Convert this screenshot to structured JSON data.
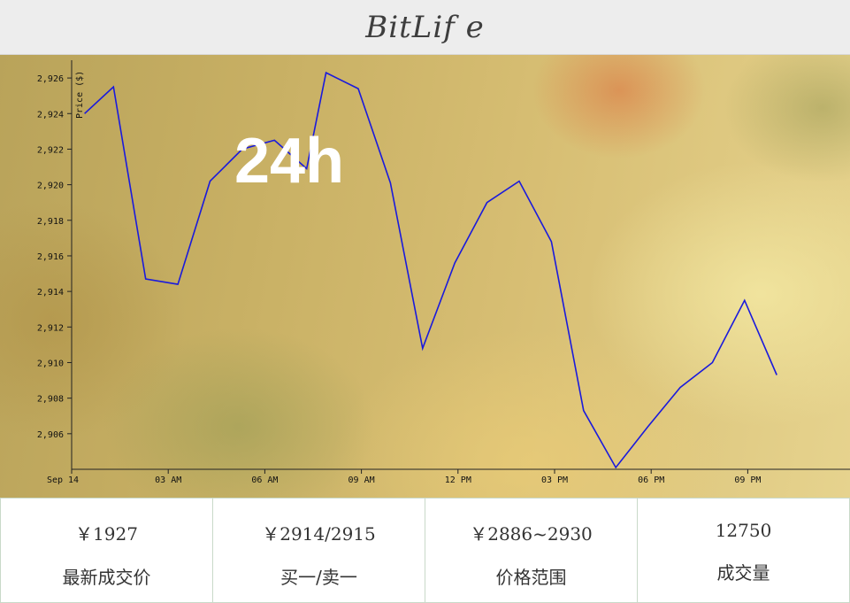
{
  "header": {
    "logo_text": "BitLif e"
  },
  "chart_overlay": {
    "title": "24h"
  },
  "chart_data": {
    "type": "line",
    "ylabel": "Price ($)",
    "xlabel": "",
    "ylim": [
      2904,
      2927
    ],
    "y_ticks": [
      2906,
      2908,
      2910,
      2912,
      2914,
      2916,
      2918,
      2920,
      2922,
      2924,
      2926
    ],
    "y_tick_labels": [
      "2,906",
      "2,908",
      "2,910",
      "2,912",
      "2,914",
      "2,916",
      "2,918",
      "2,920",
      "2,922",
      "2,924",
      "2,926"
    ],
    "x_ticks": [
      0,
      3,
      6,
      9,
      12,
      15,
      18,
      21
    ],
    "x_tick_labels": [
      "Sep 14",
      "03 AM",
      "06 AM",
      "09 AM",
      "12 PM",
      "03 PM",
      "06 PM",
      "09 PM"
    ],
    "x_unit": "hours since Sep 14 00:00",
    "line_color": "#1a1adc",
    "series": [
      {
        "x": [
          0.4,
          1.3,
          2.3,
          3.3,
          4.3,
          5.3,
          6.3,
          7.3,
          7.9,
          8.9,
          9.9,
          10.9,
          11.9,
          12.9,
          13.9,
          14.9,
          15.9,
          16.9,
          17.9,
          18.9,
          19.9,
          20.9,
          21.9
        ],
        "values": [
          2924.0,
          2925.5,
          2914.7,
          2914.4,
          2920.2,
          2922.0,
          2922.5,
          2920.9,
          2926.3,
          2925.4,
          2920.1,
          2910.8,
          2915.6,
          2919.0,
          2920.2,
          2916.8,
          2907.3,
          2904.1,
          2906.4,
          2908.6,
          2910.0,
          2913.5,
          2909.3
        ]
      }
    ]
  },
  "stats": [
    {
      "value": "￥1927",
      "label": "最新成交价"
    },
    {
      "value": "￥2914/2915",
      "label": "买一/卖一"
    },
    {
      "value": "￥2886~2930",
      "label": "价格范围"
    },
    {
      "value": "12750",
      "label": "成交量"
    }
  ]
}
